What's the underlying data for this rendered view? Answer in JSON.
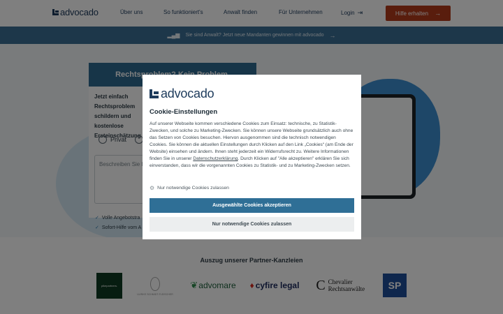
{
  "brand": {
    "name": "advocado"
  },
  "nav": {
    "items": [
      "Über uns",
      "So funktioniert's",
      "Anwalt finden",
      "Für Unternehmen"
    ],
    "login": "Login",
    "cta": "Hilfe erhalten"
  },
  "banner": {
    "text": "Sie sind Anwalt? Jetzt neue Mandanten gewinnen mit advocado"
  },
  "hero": {
    "form_title": "Rechtsproblem? Kein Problem.",
    "form_intro": "Jetzt einfach Rechtsproblem schildern und kostenlose Ersteinschätzung i",
    "radio_private": "Privat",
    "textarea_placeholder": "Beschreiben Sie h",
    "checks": [
      "Volle Angebotstra",
      "Sofort-Hilfe vom A"
    ]
  },
  "partners": {
    "title": "Auszug unserer Partner-Kanzleien",
    "logos": [
      "pikepartners.",
      "ULRIKE SCHMIDT-FLEISCHER",
      "advomare",
      "cyfire legal",
      "Chevalier Rechtsanwälte",
      "SP"
    ]
  },
  "cookie_modal": {
    "title": "Cookie-Einstellungen",
    "body_1": "Auf unserer Webseite kommen verschiedene Cookies zum Einsatz: technische, zu Statistik-Zwecken, und solche zu Marketing-Zwecken. Sie können unsere Webseite grundsätzlich auch ohne das Setzen von Cookies besuchen. Hiervon ausgenommen sind die technisch notwendigen Cookies. Sie können die aktuellen Einstellungen durch Klicken auf den Link „Cookies“ (am Ende der Website) einsehen und ändern. Ihnen steht jederzeit ein Widerrufsrecht zu. Weitere Informationen finden Sie in unserer ",
    "link": "Datenschutzerklärung",
    "body_2": ". Durch Klicken auf \"Alle akzeptieren\" erklären Sie sich einverstanden, dass wir die vorgenannten Cookies zu Statistik- und zu Marketing-Zwecken setzen.",
    "option": "Nur notwendige Cookies zulassen",
    "accept_button": "Ausgewählte Cookies akzeptieren",
    "necessary_button": "Nur notwendige Cookies zulassen"
  },
  "colors": {
    "primary": "#2f6f96",
    "cta": "#b33a1a",
    "navy": "#1d3b5c",
    "banner": "#3b6f94"
  }
}
